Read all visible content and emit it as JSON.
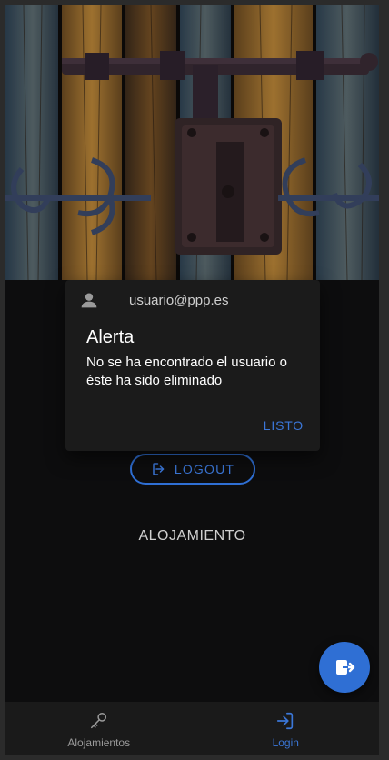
{
  "dialog": {
    "user_email": "usuario@ppp.es",
    "title": "Alerta",
    "message": "No se ha encontrado el usuario o éste ha sido eliminado",
    "ok_label": "LISTO"
  },
  "form": {
    "logout_label": "LOGOUT",
    "section_title": "ALOJAMIENTO"
  },
  "bottom_nav": {
    "items": [
      {
        "label": "Alojamientos",
        "icon": "key-icon",
        "active": false
      },
      {
        "label": "Login",
        "icon": "login-icon",
        "active": true
      }
    ]
  },
  "fab": {
    "icon": "logout-icon"
  },
  "colors": {
    "accent": "#2f6fd4",
    "background": "#0d0d0e",
    "dialog_bg": "#1b1b1b",
    "nav_bg": "#1a1a1a"
  }
}
